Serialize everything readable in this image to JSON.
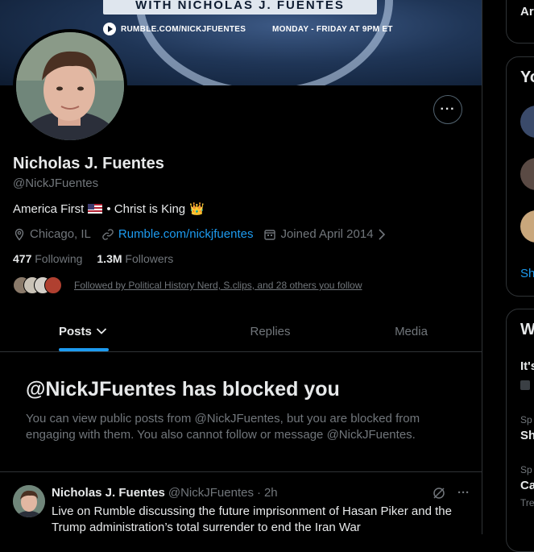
{
  "banner": {
    "title": "WITH NICHOLAS J. FUENTES",
    "link": "RUMBLE.COM/NICKJFUENTES",
    "schedule": "MONDAY - FRIDAY AT 9PM ET"
  },
  "profile": {
    "more_label": "···",
    "name": "Nicholas J. Fuentes",
    "handle": "@NickJFuentes",
    "bio_start": "America First",
    "bio_mid": "• Christ is King",
    "bio_emoji": "👑",
    "location": "Chicago, IL",
    "website": "Rumble.com/nickjfuentes",
    "joined": "Joined April 2014",
    "following_count": "477",
    "following_label": "Following",
    "followers_count": "1.3M",
    "followers_label": "Followers",
    "followed_by": "Followed by Political History Nerd, S.clips, and 28 others you follow"
  },
  "tabs": [
    {
      "label": "Posts",
      "icon": "chevron-down-icon"
    },
    {
      "label": "Replies"
    },
    {
      "label": "Media"
    }
  ],
  "blocked": {
    "title": "@NickJFuentes has blocked you",
    "description": "You can view public posts from @NickJFuentes, but you are blocked from engaging with them. You also cannot follow or message @NickJFuentes."
  },
  "tweet": {
    "author": "Nicholas J. Fuentes",
    "handle": "@NickJFuentes",
    "separator": "·",
    "time": "2h",
    "text": "Live on Rumble discussing the future imprisonment of Hasan Piker and the Trump administration’s total surrender to end the Iran War",
    "more_label": "···"
  },
  "sidebar": {
    "card1_text": "Ar",
    "card2_title": "Yo",
    "card2_show": "Sh",
    "card3_title": "W",
    "card3_item1": "It's",
    "card3_small1": "Sp",
    "card3_item2": "Sh",
    "card3_small2": "Sp",
    "card3_item3": "Ca",
    "card3_small3": "Tre"
  },
  "colors": {
    "accent": "#1d9bf0",
    "muted": "#71767b",
    "border": "#2f3336"
  }
}
